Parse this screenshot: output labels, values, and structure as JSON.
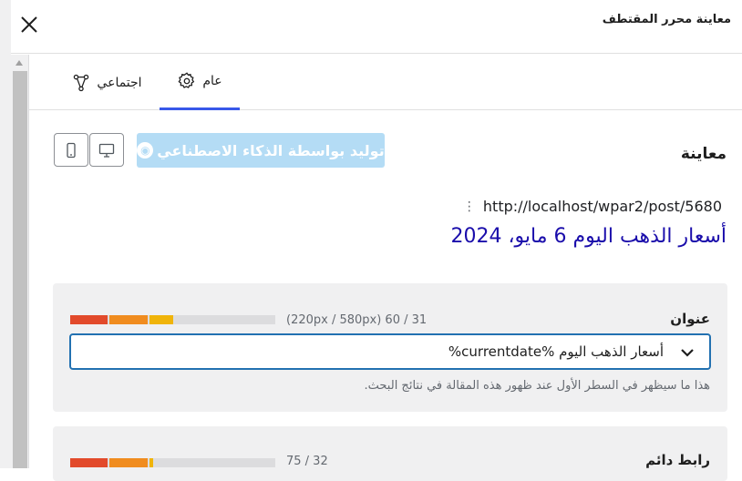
{
  "header": {
    "title": "معاينة محرر المقتطف"
  },
  "tabs": [
    {
      "label": "عام",
      "icon": "gear-icon"
    },
    {
      "label": "اجتماعي",
      "icon": "share-icon"
    }
  ],
  "toolbar": {
    "ai_button_label": "توليد بواسطة الذكاء الاصطناعي"
  },
  "preview": {
    "label": "معاينة",
    "url": "http://localhost/wpar2/post/5680",
    "title": "أسعار الذهب اليوم 6 مايو، 2024"
  },
  "title_field": {
    "label": "عنوان",
    "counter": "(220px / 580px) 60 / 31",
    "value": "أسعار الذهب اليوم  %currentdate%",
    "help": "هذا ما سيظهر في السطر الأول عند ظهور هذه المقالة في نتائج البحث.",
    "fill_fraction": 0.52
  },
  "permalink_field": {
    "label": "رابط دائم",
    "counter": "75 / 32",
    "fill_fraction": 0.43
  },
  "colors": {
    "accent": "#3858e9",
    "input_border": "#2271b1",
    "ai_button": "#b4dcf5",
    "serp_title": "#1a0dab",
    "bar_red": "#e24a2b",
    "bar_orange": "#f08c1f",
    "bar_yellow": "#f0b40a"
  }
}
